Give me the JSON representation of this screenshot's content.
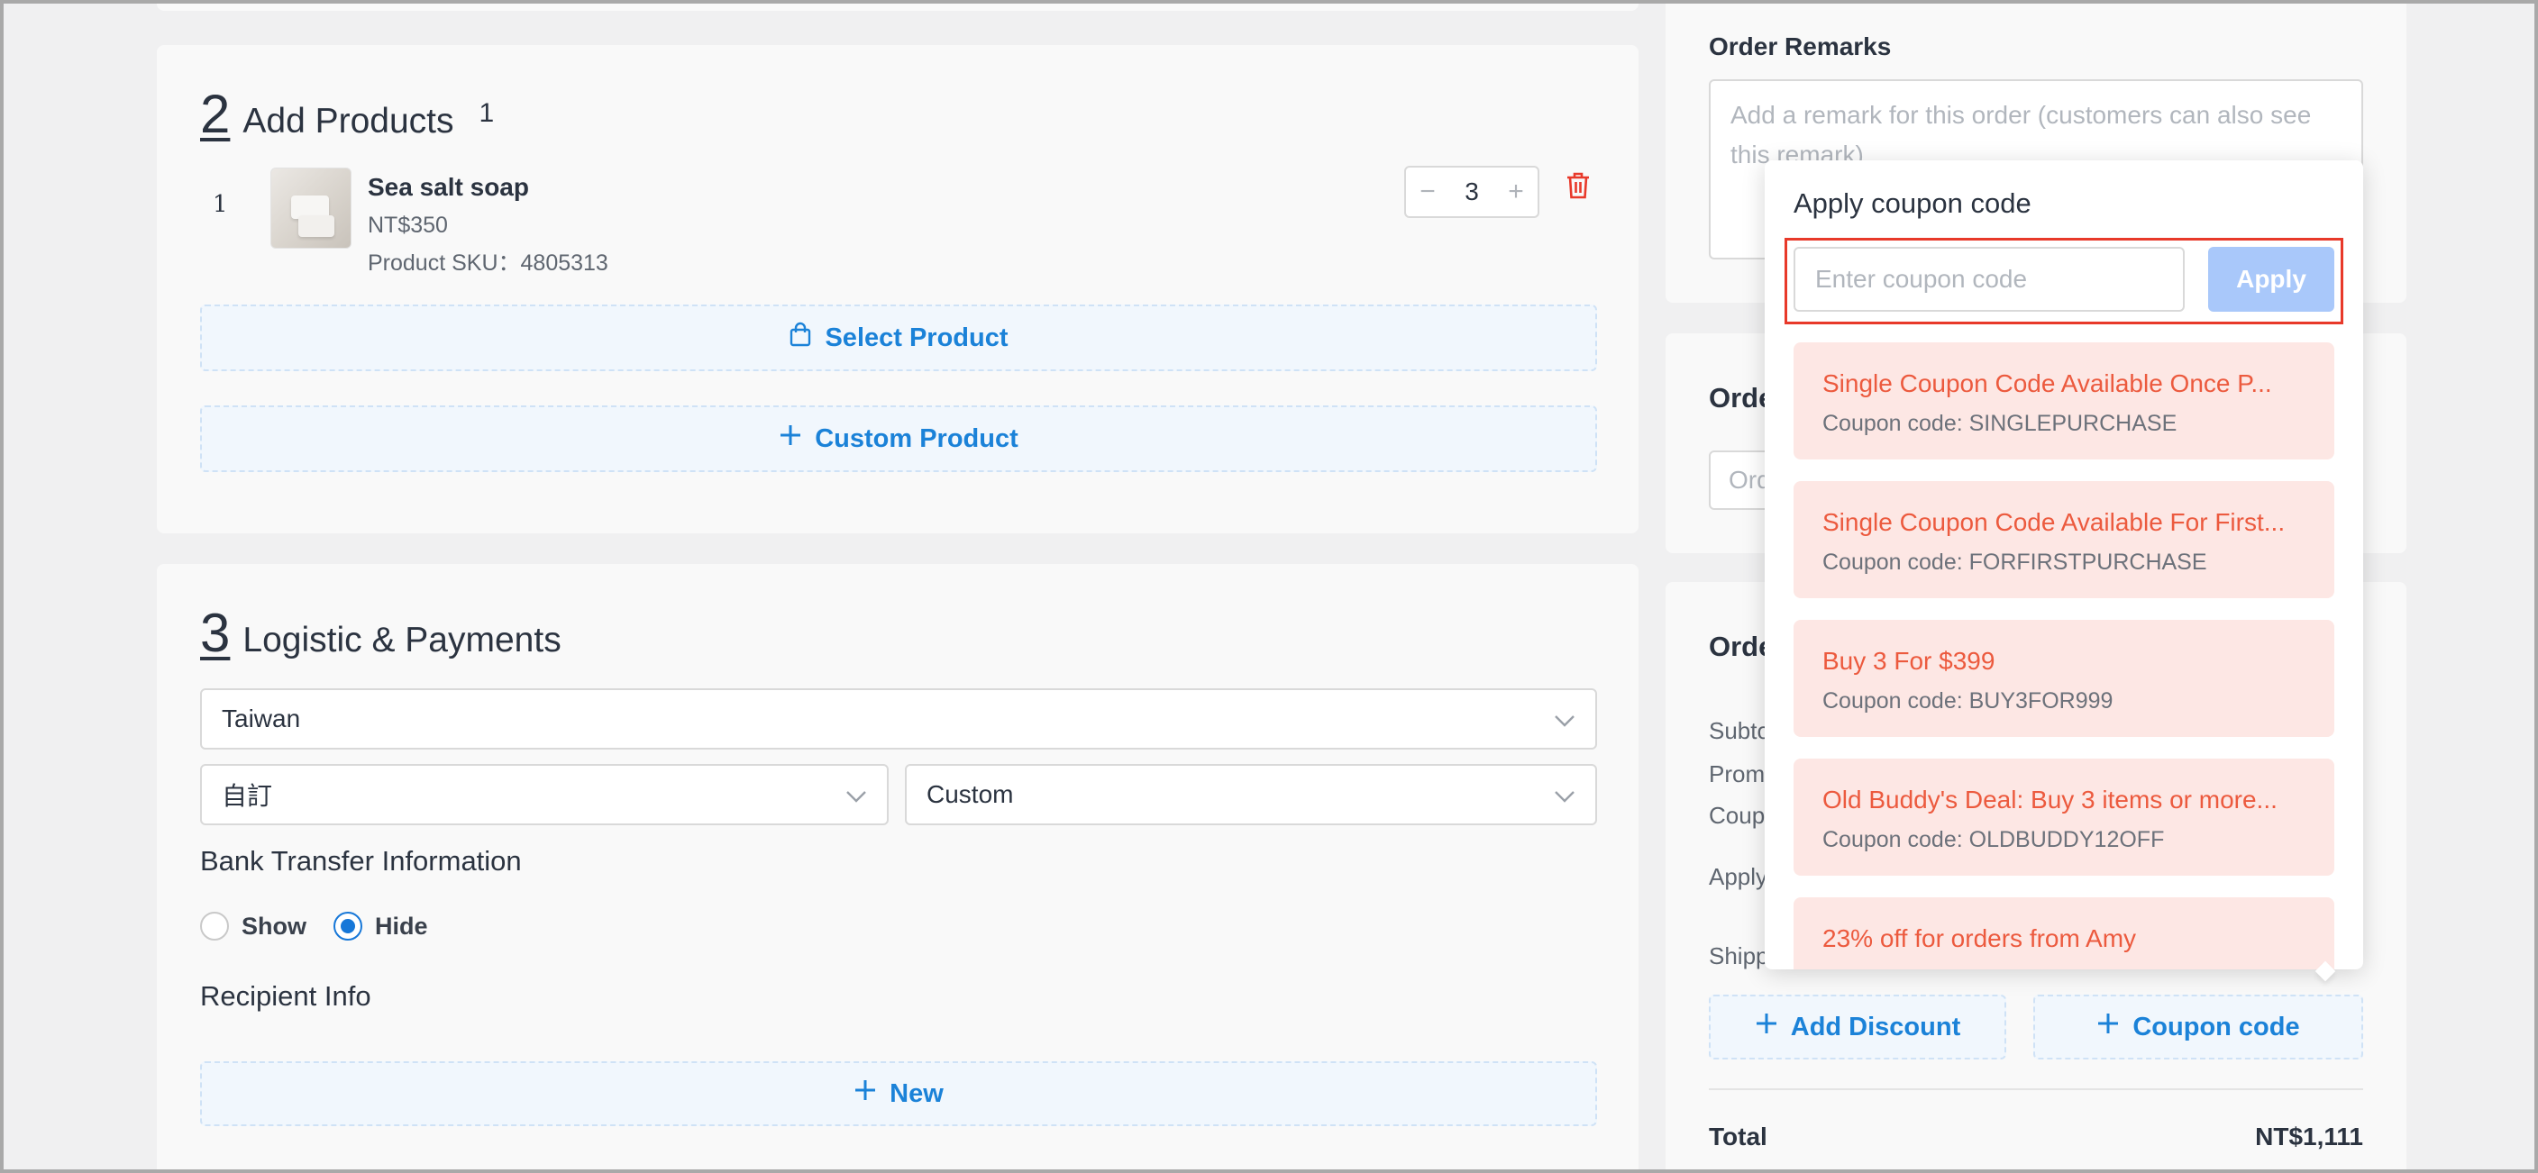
{
  "products_section": {
    "step": "2",
    "title": "Add Products",
    "count": "1",
    "items": [
      {
        "index": "1",
        "name": "Sea salt soap",
        "price": "NT$350",
        "sku": "Product SKU：4805313",
        "quantity": "3"
      }
    ],
    "select_product_label": "Select Product",
    "custom_product_label": "Custom Product"
  },
  "logistics_section": {
    "step": "3",
    "title": "Logistic & Payments",
    "country": "Taiwan",
    "shipping_method": "自訂",
    "payment_method": "Custom",
    "bank_transfer_title": "Bank Transfer Information",
    "bank_options": [
      "Show",
      "Hide"
    ],
    "bank_selected": "Hide",
    "recipient_title": "Recipient Info",
    "new_label": "New"
  },
  "remarks": {
    "title": "Order Remarks",
    "placeholder": "Add a remark for this order (customers can also see this remark)"
  },
  "order_info": {
    "title_partial": "Orde",
    "input_partial": "Ord"
  },
  "summary": {
    "title_partial": "Orde",
    "rows": [
      "Subto",
      "Prom",
      "Coup",
      "Apply",
      "Shipp"
    ],
    "add_discount_label": "Add Discount",
    "coupon_code_label": "Coupon code",
    "total_label": "Total",
    "total_value": "NT$1,111"
  },
  "coupon_popup": {
    "title": "Apply coupon code",
    "input_placeholder": "Enter coupon code",
    "apply_label": "Apply",
    "coupons": [
      {
        "title": "Single Coupon Code Available Once P...",
        "code": "Coupon code: SINGLEPURCHASE"
      },
      {
        "title": "Single Coupon Code Available For First...",
        "code": "Coupon code: FORFIRSTPURCHASE"
      },
      {
        "title": "Buy 3 For $399",
        "code": "Coupon code: BUY3FOR999"
      },
      {
        "title": "Old Buddy's Deal: Buy 3 items or more...",
        "code": "Coupon code: OLDBUDDY12OFF"
      },
      {
        "title": "23% off for orders from Amy",
        "code": ""
      }
    ]
  },
  "colors": {
    "accent": "#1b82d8",
    "apply_button": "#a9c8fa",
    "coupon_bg": "#fde7e4",
    "coupon_text": "#ec5a3e",
    "highlight_border": "#e8392a",
    "delete_icon": "#e8392a"
  }
}
